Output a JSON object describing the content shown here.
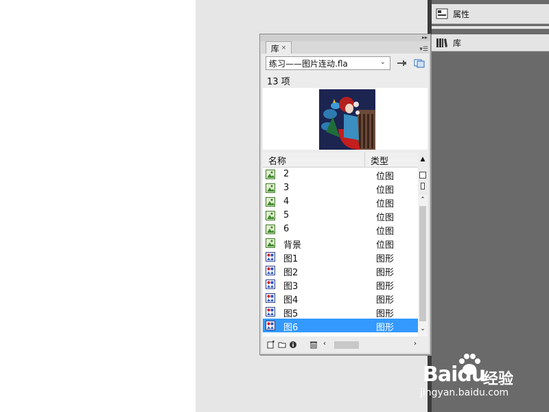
{
  "dock": {
    "properties_label": "属性",
    "library_label": "库"
  },
  "library_panel": {
    "tab_label": "库",
    "tab_close": "×",
    "document_select": "练习——图片连动.fla",
    "item_count": "13 项",
    "columns": {
      "name": "名称",
      "type": "类型"
    },
    "items": [
      {
        "name": "2",
        "type": "位图",
        "icon": "bitmap-icon",
        "selected": false
      },
      {
        "name": "3",
        "type": "位图",
        "icon": "bitmap-icon",
        "selected": false
      },
      {
        "name": "4",
        "type": "位图",
        "icon": "bitmap-icon",
        "selected": false
      },
      {
        "name": "5",
        "type": "位图",
        "icon": "bitmap-icon",
        "selected": false
      },
      {
        "name": "6",
        "type": "位图",
        "icon": "bitmap-icon",
        "selected": false
      },
      {
        "name": "背景",
        "type": "位图",
        "icon": "bitmap-icon",
        "selected": false
      },
      {
        "name": "图1",
        "type": "图形",
        "icon": "graphic-symbol-icon",
        "selected": false
      },
      {
        "name": "图2",
        "type": "图形",
        "icon": "graphic-symbol-icon",
        "selected": false
      },
      {
        "name": "图3",
        "type": "图形",
        "icon": "graphic-symbol-icon",
        "selected": false
      },
      {
        "name": "图4",
        "type": "图形",
        "icon": "graphic-symbol-icon",
        "selected": false
      },
      {
        "name": "图5",
        "type": "图形",
        "icon": "graphic-symbol-icon",
        "selected": false
      },
      {
        "name": "图6",
        "type": "图形",
        "icon": "graphic-symbol-icon",
        "selected": true
      }
    ],
    "selection_color": "#3399ff"
  },
  "watermark": {
    "brand": "Bai",
    "brand_suffix": "du",
    "product": "经验",
    "url": "jingyan.baidu.com"
  }
}
